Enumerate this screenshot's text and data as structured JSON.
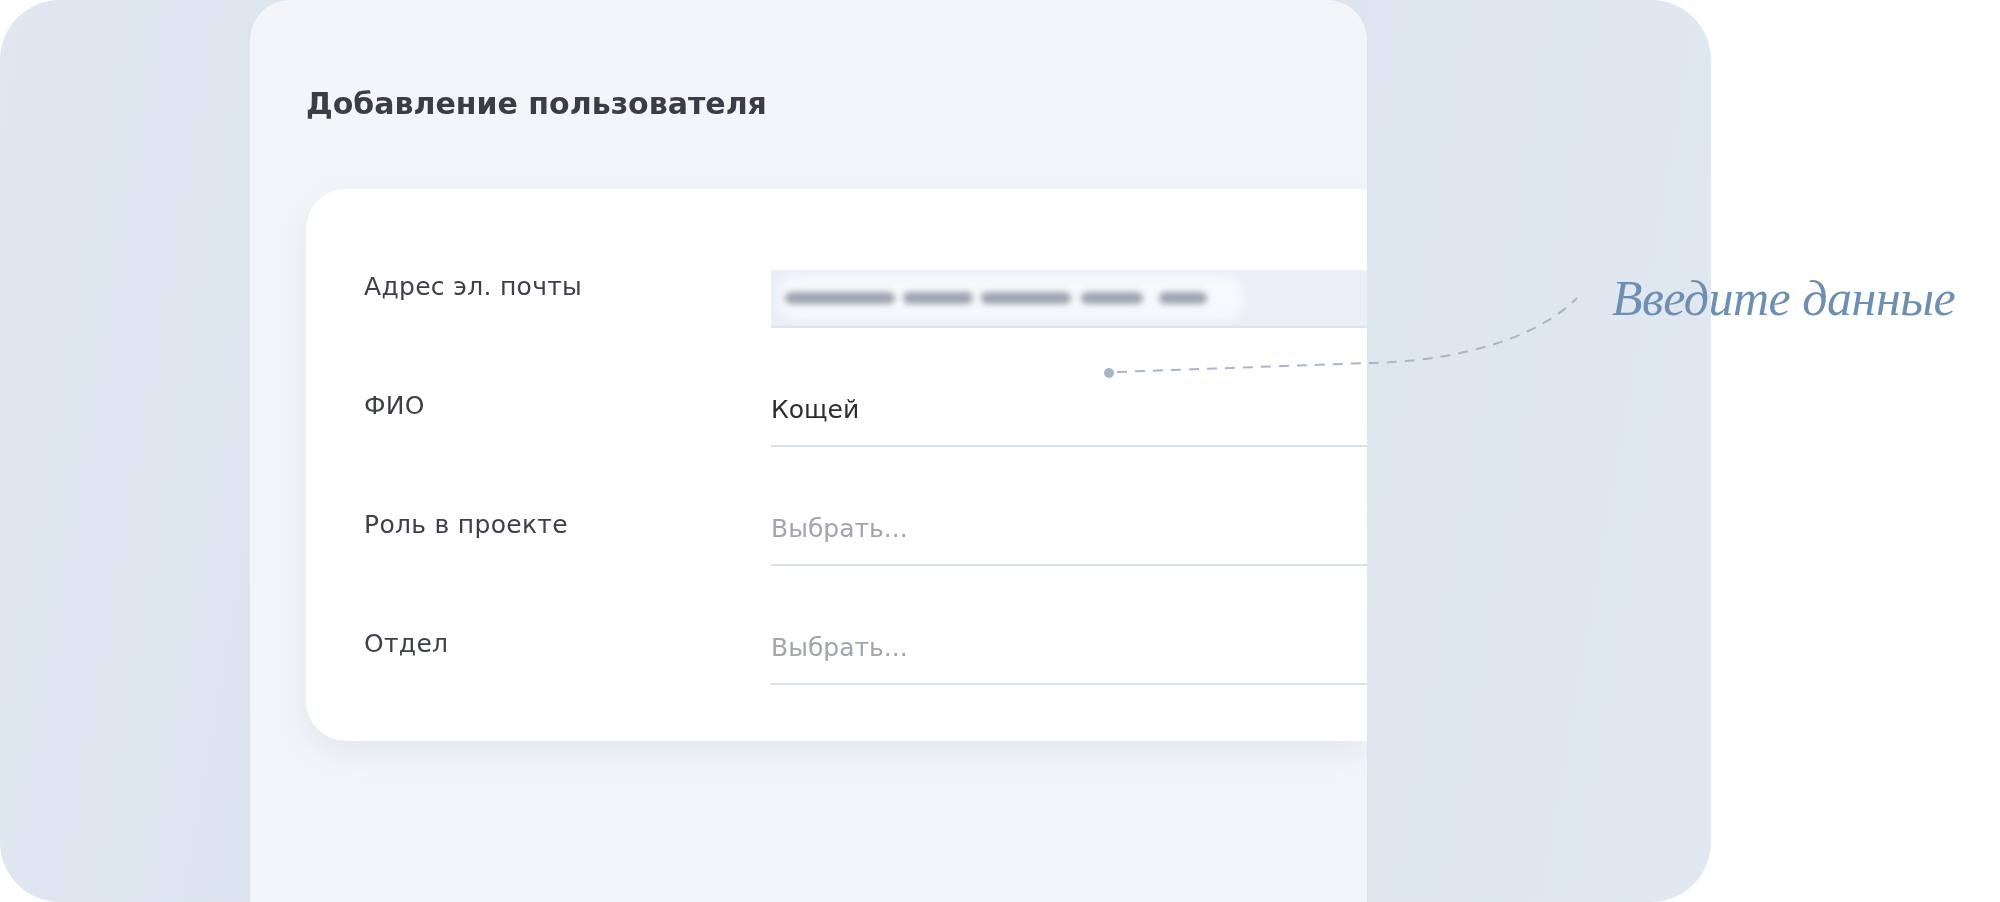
{
  "form": {
    "title": "Добавление пользователя",
    "fields": [
      {
        "label": "Адрес эл. почты",
        "highlighted": true,
        "value_blurred": true
      },
      {
        "label": "ФИО",
        "highlighted": false,
        "value_blurred": false,
        "value": "Кощей"
      },
      {
        "label": "Роль в проекте",
        "highlighted": false,
        "value_blurred": false,
        "placeholder": "Выбрать..."
      },
      {
        "label": "Отдел",
        "highlighted": false,
        "value_blurred": false,
        "placeholder": "Выбрать..."
      }
    ]
  },
  "annotation": {
    "text": "Введите данные"
  }
}
